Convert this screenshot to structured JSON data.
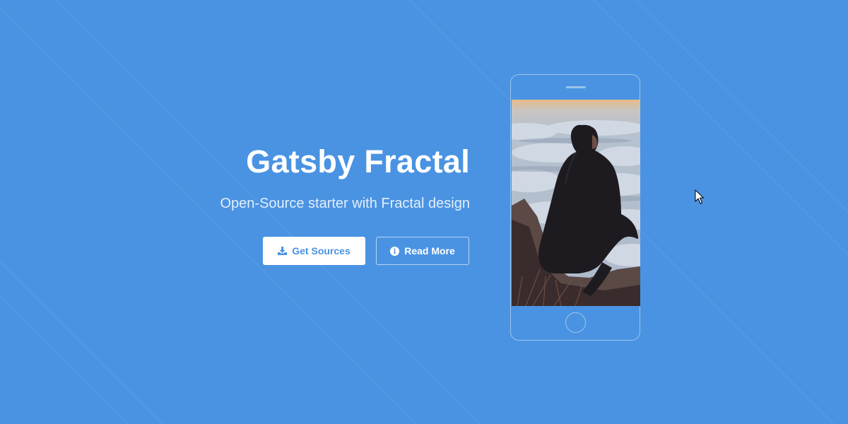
{
  "hero": {
    "title": "Gatsby Fractal",
    "subtitle": "Open-Source starter with Fractal design"
  },
  "buttons": {
    "primary_label": "Get Sources",
    "primary_icon": "download-icon",
    "secondary_label": "Read More",
    "secondary_icon": "info-circle-icon"
  },
  "phone": {
    "screen_image": "man sitting on rock above clouds"
  },
  "colors": {
    "background": "#4a93e2",
    "primary_button_bg": "#ffffff",
    "primary_button_text": "#4a93e2",
    "text": "#ffffff"
  }
}
